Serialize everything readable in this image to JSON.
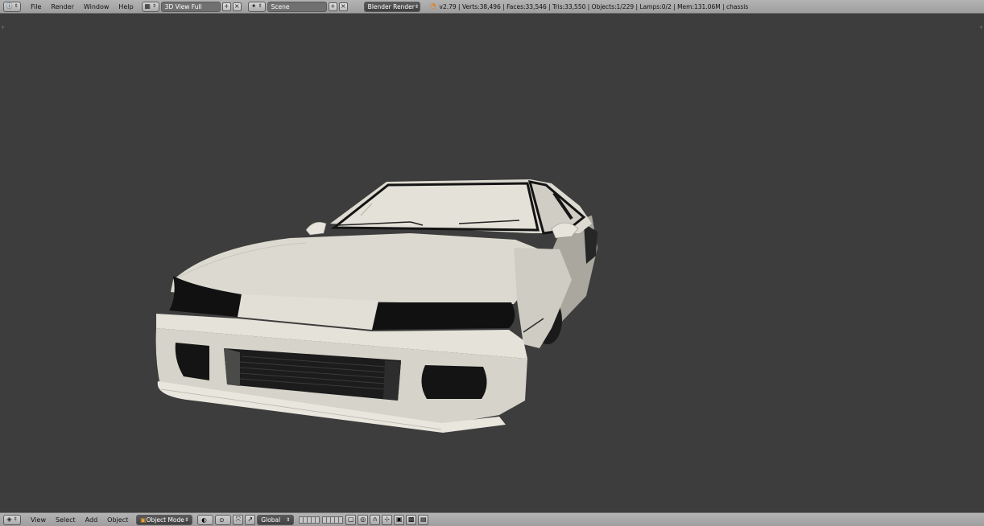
{
  "top_bar": {
    "menus": [
      "File",
      "Render",
      "Window",
      "Help"
    ],
    "screen_layout": "3D View Full",
    "scene": "Scene",
    "render_engine": "Blender Render",
    "stats": "v2.79 | Verts:38,496 | Faces:33,546 | Tris:33,550 | Objects:1/229 | Lamps:0/2 | Mem:131.06M | chassis"
  },
  "bottom_bar": {
    "menus": [
      "View",
      "Select",
      "Add",
      "Object"
    ],
    "mode": "Object Mode",
    "orientation": "Global"
  },
  "colors": {
    "viewport_bg": "#3d3d3d",
    "header_bg": "#a6a6a6",
    "car_body": "#d9d7cc",
    "blender_orange": "#e87d0d"
  }
}
